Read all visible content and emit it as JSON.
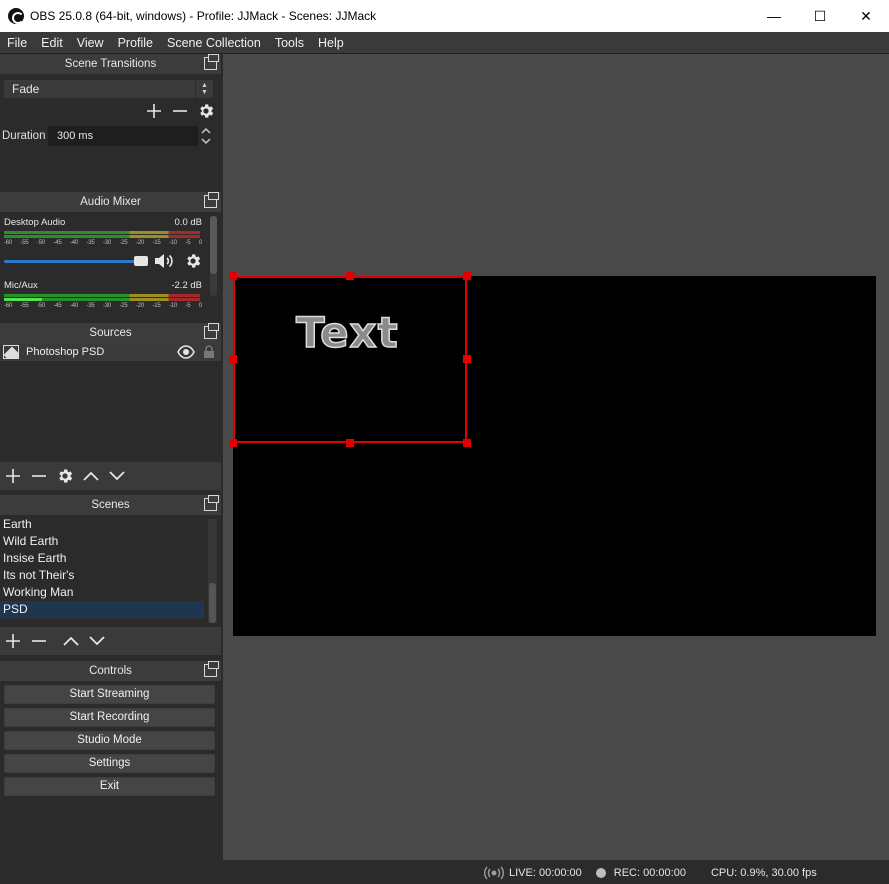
{
  "window": {
    "title": "OBS 25.0.8 (64-bit, windows) - Profile: JJMack - Scenes: JJMack",
    "minimize": "—",
    "maximize": "☐",
    "close": "✕"
  },
  "menu": [
    "File",
    "Edit",
    "View",
    "Profile",
    "Scene Collection",
    "Tools",
    "Help"
  ],
  "scene_transitions": {
    "title": "Scene Transitions",
    "selected": "Fade",
    "duration_label": "Duration",
    "duration_value": "300 ms"
  },
  "audio_mixer": {
    "title": "Audio Mixer",
    "ticks": [
      "-60",
      "-55",
      "-50",
      "-45",
      "-40",
      "-35",
      "-30",
      "-25",
      "-20",
      "-15",
      "-10",
      "-5",
      "0"
    ],
    "channels": [
      {
        "name": "Desktop Audio",
        "level": "0.0 dB"
      },
      {
        "name": "Mic/Aux",
        "level": "-2.2 dB"
      }
    ]
  },
  "sources": {
    "title": "Sources",
    "items": [
      {
        "name": "Photoshop PSD"
      }
    ]
  },
  "scenes": {
    "title": "Scenes",
    "items": [
      "Earth",
      "Wild Earth",
      "Insise Earth",
      "Its not Their's",
      "Working Man",
      "PSD"
    ],
    "selected": "PSD"
  },
  "controls": {
    "title": "Controls",
    "buttons": [
      "Start Streaming",
      "Start Recording",
      "Studio Mode",
      "Settings",
      "Exit"
    ]
  },
  "preview": {
    "text": "Text"
  },
  "status": {
    "live": "LIVE: 00:00:00",
    "rec": "REC: 00:00:00",
    "cpu": "CPU: 0.9%, 30.00 fps"
  }
}
